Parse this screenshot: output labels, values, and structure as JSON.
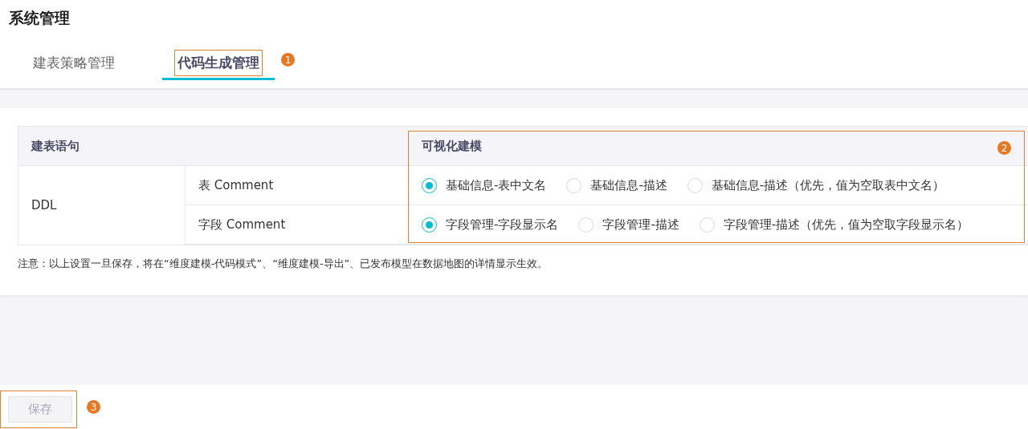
{
  "page_title": "系统管理",
  "tabs": [
    {
      "label": "建表策略管理",
      "selected": false
    },
    {
      "label": "代码生成管理",
      "selected": true,
      "callout": "1"
    }
  ],
  "table": {
    "columns": [
      "建表语句",
      "可视化建模"
    ],
    "options_callout": "2",
    "group_label": "DDL",
    "rows": [
      {
        "label": "表 Comment",
        "options": [
          {
            "label": "基础信息-表中文名",
            "selected": true
          },
          {
            "label": "基础信息-描述",
            "selected": false
          },
          {
            "label": "基础信息-描述（优先，值为空取表中文名）",
            "selected": false
          }
        ]
      },
      {
        "label": "字段 Comment",
        "options": [
          {
            "label": "字段管理-字段显示名",
            "selected": true
          },
          {
            "label": "字段管理-描述",
            "selected": false
          },
          {
            "label": "字段管理-描述（优先，值为空取字段显示名）",
            "selected": false
          }
        ]
      }
    ]
  },
  "note": "注意：以上设置一旦保存，将在“维度建模-代码模式”、“维度建模-导出”、已发布模型在数据地图的详情显示生效。",
  "save_button": {
    "label": "保存",
    "disabled": true,
    "callout": "3"
  }
}
